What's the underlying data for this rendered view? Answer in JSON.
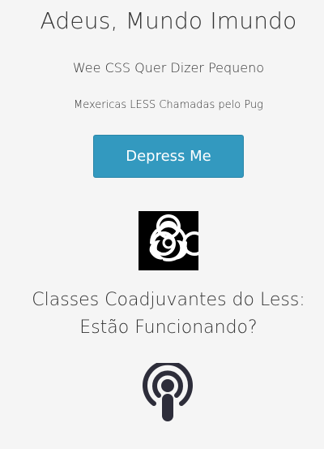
{
  "header": {
    "title": "Adeus, Mundo Imundo"
  },
  "main": {
    "subtitle": "Wee CSS Quer Dizer Pequeno",
    "small_text": "Mexericas LESS Chamadas pelo Pug",
    "button_label": "Depress Me",
    "heading2_line1": "Classes Coadjuvantes do Less:",
    "heading2_line2": "Estão Funcionando?"
  },
  "icons": {
    "biohazard": "biohazard-icon",
    "podcast": "podcast-icon"
  },
  "colors": {
    "background": "#f5f5f5",
    "button": "#3399bf",
    "button_text": "#ffffff",
    "text": "#333333",
    "podcast_icon": "#2d2d3a"
  }
}
